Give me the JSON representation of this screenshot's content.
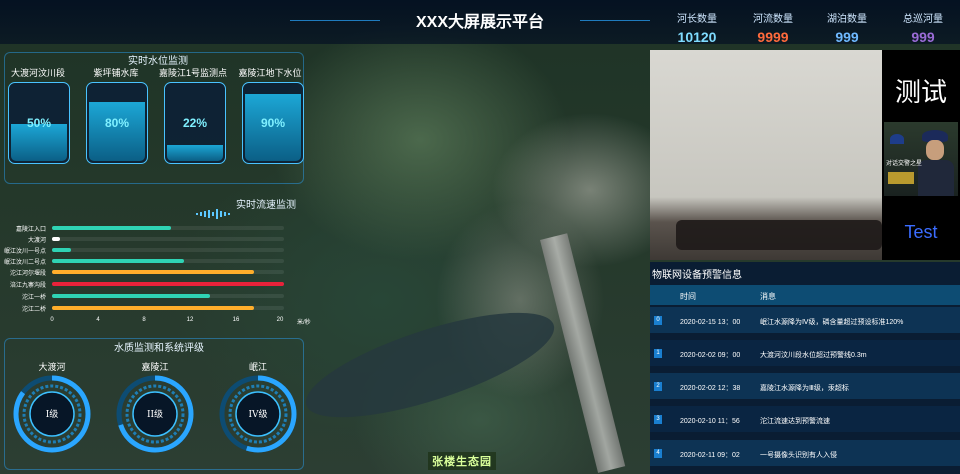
{
  "header": {
    "title": "XXX大屏展示平台",
    "stats": [
      {
        "label": "河长数量",
        "value": "10120",
        "color": "#7fdcff"
      },
      {
        "label": "河流数量",
        "value": "9999",
        "color": "#ff6a3c"
      },
      {
        "label": "湖泊数量",
        "value": "999",
        "color": "#6fb9ff"
      },
      {
        "label": "总巡河量",
        "value": "999",
        "color": "#9a6bd6"
      }
    ]
  },
  "water_level": {
    "title": "实时水位监测",
    "gauges": [
      {
        "name": "大渡河汶川段",
        "percent_label": "50%",
        "level": 0.5
      },
      {
        "name": "紫坪铺水库",
        "percent_label": "80%",
        "level": 0.8
      },
      {
        "name": "嘉陵江1号监测点",
        "percent_label": "22%",
        "level": 0.22
      },
      {
        "name": "嘉陵江地下水位",
        "percent_label": "90%",
        "level": 0.9
      }
    ]
  },
  "flow": {
    "title": "实时流速监测",
    "unit": "米/秒",
    "chart_data": {
      "type": "bar",
      "orientation": "horizontal",
      "categories": [
        "嘉陵江入口",
        "大渡河",
        "岷江汶川一号点",
        "岷江汶川二号点",
        "沱江河尔堰段",
        "涪江九寨沟段",
        "沱江一桥",
        "沱江二桥"
      ],
      "values": [
        10.3,
        0.7,
        1.6,
        11.4,
        17.4,
        20,
        13.6,
        17.4
      ],
      "colors": [
        "#2fd3b4",
        "#ffffff",
        "#2fd3b4",
        "#2fd3b4",
        "#ffae2b",
        "#e8223a",
        "#2fd3b4",
        "#ffae2b"
      ],
      "xlim": [
        0,
        20
      ],
      "xticks": [
        "0",
        "4",
        "8",
        "12",
        "16",
        "20"
      ]
    }
  },
  "quality": {
    "title": "水质监测和系统评级",
    "rings": [
      {
        "name": "大渡河",
        "grade": "I级",
        "value": 0.85
      },
      {
        "name": "嘉陵江",
        "grade": "II级",
        "value": 0.7
      },
      {
        "name": "岷江",
        "grade": "IV级",
        "value": 0.55
      }
    ]
  },
  "video": {
    "side_title": "测试",
    "side_caption": "Test",
    "photo_caption": "对话交警之星"
  },
  "map": {
    "label": "张楼生态园"
  },
  "alerts": {
    "title": "物联网设备预警信息",
    "col_time": "时间",
    "col_msg": "消息",
    "rows": [
      {
        "num": "0",
        "time": "2020-02-15 13：00",
        "msg": "岷江水源降为Ⅳ级，磷含量超过预设标准120%"
      },
      {
        "num": "1",
        "time": "2020-02-02 09：00",
        "msg": "大渡河汶川段水位超过预警线0.3m"
      },
      {
        "num": "2",
        "time": "2020-02-02 12：38",
        "msg": "嘉陵江水源降为Ⅲ级，汞超标"
      },
      {
        "num": "3",
        "time": "2020-02-10 11：56",
        "msg": "沱江流速达到预警流速"
      },
      {
        "num": "4",
        "time": "2020-02-11 09：02",
        "msg": "一号摄像头识别有人入侵"
      }
    ]
  }
}
